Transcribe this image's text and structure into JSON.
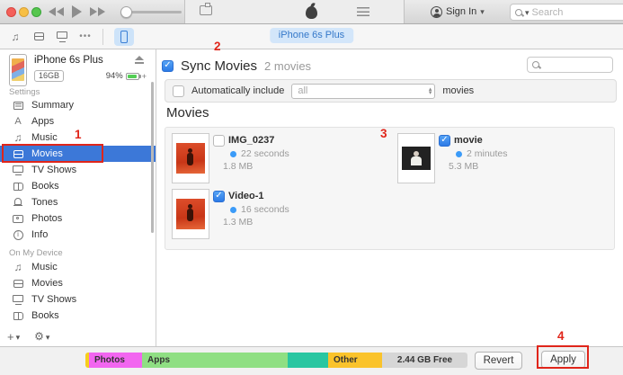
{
  "colors": {
    "selection_blue": "#3c78d8",
    "checkbox_blue": "#2c7ae6",
    "device_badge_blue": "#d3e6fa",
    "annotation_red": "#e0251a",
    "battery_green": "#54ce55",
    "duration_dot_blue": "#3b9bf8",
    "capacity": {
      "audio": "#f6cf1d",
      "photos": "#f266f0",
      "apps": "#8fdf83",
      "documents": "#29c6a1",
      "other": "#fac32b",
      "free": "#d6d6d6"
    }
  },
  "titlebar": {
    "sign_in_label": "Sign In",
    "search_placeholder": "Search"
  },
  "navbar": {
    "device_badge": "iPhone 6s Plus"
  },
  "sidebar": {
    "device": {
      "name": "iPhone 6s Plus",
      "capacity": "16GB",
      "battery_percent": "94%",
      "charging_indicator": "+"
    },
    "settings_header": "Settings",
    "settings_items": [
      {
        "label": "Summary",
        "selected": false
      },
      {
        "label": "Apps",
        "selected": false
      },
      {
        "label": "Music",
        "selected": false
      },
      {
        "label": "Movies",
        "selected": true
      },
      {
        "label": "TV Shows",
        "selected": false
      },
      {
        "label": "Books",
        "selected": false
      },
      {
        "label": "Tones",
        "selected": false
      },
      {
        "label": "Photos",
        "selected": false
      },
      {
        "label": "Info",
        "selected": false
      }
    ],
    "on_device_header": "On My Device",
    "on_device_items": [
      {
        "label": "Music"
      },
      {
        "label": "Movies"
      },
      {
        "label": "TV Shows"
      },
      {
        "label": "Books"
      }
    ]
  },
  "main": {
    "sync_title": "Sync Movies",
    "sync_count": "2 movies",
    "sync_checked": true,
    "auto_include_label": "Automatically include",
    "auto_include_checked": false,
    "auto_include_value": "all",
    "auto_include_suffix": "movies",
    "movies_title": "Movies",
    "movies": [
      {
        "name": "IMG_0237",
        "duration": "22 seconds",
        "size": "1.8 MB",
        "checked": false
      },
      {
        "name": "movie",
        "duration": "2 minutes",
        "size": "5.3 MB",
        "checked": true
      },
      {
        "name": "Video-1",
        "duration": "16 seconds",
        "size": "1.3 MB",
        "checked": true
      }
    ]
  },
  "footer": {
    "capacity_segments": [
      {
        "name": "audio",
        "label": ""
      },
      {
        "name": "photos",
        "label": "Photos"
      },
      {
        "name": "apps",
        "label": "Apps"
      },
      {
        "name": "documents",
        "label": ""
      },
      {
        "name": "other",
        "label": "Other"
      },
      {
        "name": "free",
        "label": "2.44 GB Free"
      }
    ],
    "revert_label": "Revert",
    "apply_label": "Apply"
  },
  "annotations": {
    "step1": "1",
    "step2": "2",
    "step3": "3",
    "step4": "4"
  }
}
